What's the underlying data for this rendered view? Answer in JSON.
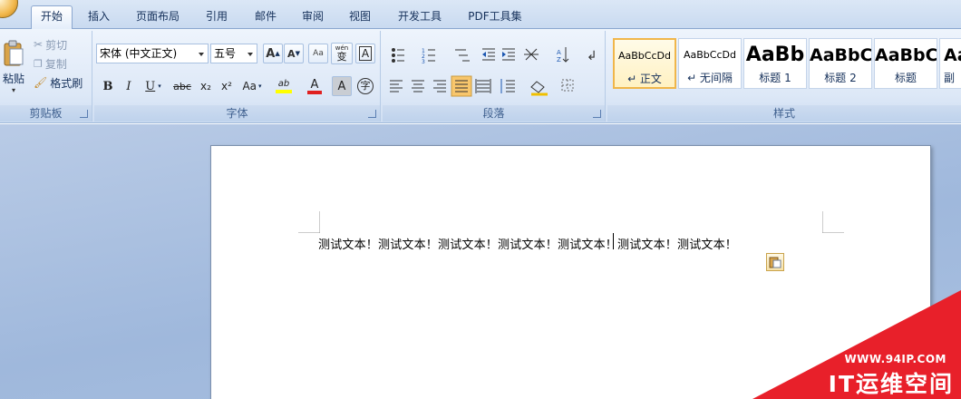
{
  "tabs": [
    "开始",
    "插入",
    "页面布局",
    "引用",
    "邮件",
    "审阅",
    "视图",
    "开发工具",
    "PDF工具集"
  ],
  "clipboard": {
    "paste_label": "粘贴",
    "cut_label": "剪切",
    "copy_label": "复制",
    "format_painter_label": "格式刷",
    "group_label": "剪贴板"
  },
  "font": {
    "font_name": "宋体 (中文正文)",
    "font_size": "五号",
    "grow_label": "A",
    "shrink_label": "A",
    "phonetic_label": "wén",
    "phonetic_char": "变",
    "border_char": "A",
    "bold_label": "B",
    "italic_label": "I",
    "underline_label": "U",
    "strike_label": "abc",
    "subscript_label": "x₂",
    "superscript_label": "x²",
    "case_label": "Aa",
    "highlight_label": "ab",
    "font_color_label": "A",
    "shading_label": "A",
    "enclose_label": "字",
    "group_label": "字体"
  },
  "paragraph": {
    "group_label": "段落"
  },
  "styles": {
    "group_label": "样式",
    "items": [
      {
        "sample": "AaBbCcDd",
        "name": "↵ 正文"
      },
      {
        "sample": "AaBbCcDd",
        "name": "↵ 无间隔"
      },
      {
        "sample": "AaBb",
        "name": "标题 1"
      },
      {
        "sample": "AaBbC",
        "name": "标题 2"
      },
      {
        "sample": "AaBbC",
        "name": "标题"
      },
      {
        "sample": "Aa",
        "name": "副"
      }
    ]
  },
  "document": {
    "text": "测试文本！测试文本！测试文本！测试文本！测试文本！测试文本！测试文本！"
  },
  "watermark": {
    "url": "WWW.94IP.COM",
    "brand": "IT运维空间"
  },
  "colors": {
    "highlight": "#ffff00",
    "font_color": "#e02020",
    "watermark": "#e8202a"
  }
}
